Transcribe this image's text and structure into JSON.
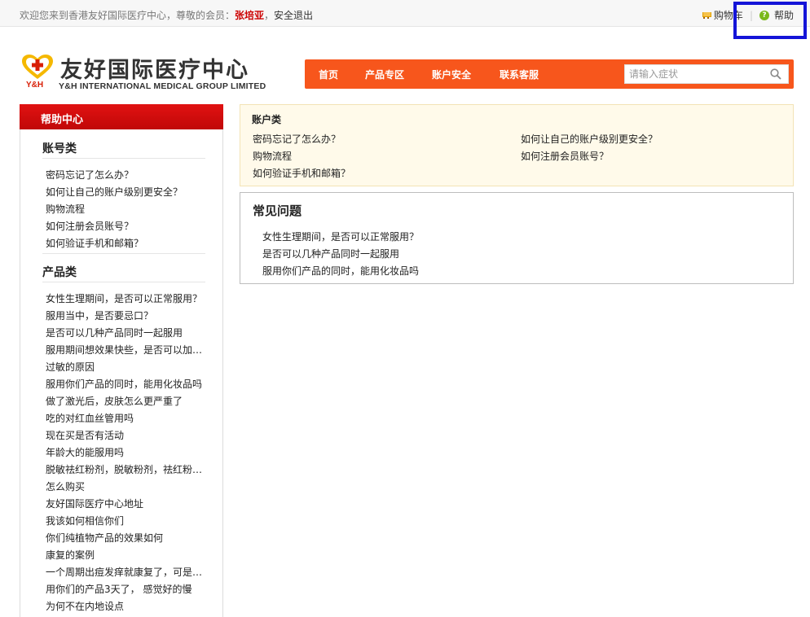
{
  "topbar": {
    "welcome_prefix": "欢迎您来到香港友好国际医疗中心，尊敬的会员：",
    "member_name": "张培亚",
    "logout_sep": "，",
    "logout": "安全退出",
    "cart_label": "购物车",
    "separator": "|",
    "help_label": "帮助"
  },
  "logo": {
    "mark_text": "Y&H",
    "name_cn": "友好国际医疗中心",
    "name_en": "Y&H INTERNATIONAL MEDICAL GROUP LIMITED",
    "brand_red": "#d81e06",
    "brand_yellow": "#f5b800"
  },
  "nav": {
    "items": [
      {
        "label": "首页"
      },
      {
        "label": "产品专区"
      },
      {
        "label": "账户安全"
      },
      {
        "label": "联系客服"
      }
    ],
    "search_placeholder": "请输入症状",
    "color": "#f7561c"
  },
  "sidebar": {
    "header": "帮助中心",
    "header_color": "#cc0b0b",
    "sections": [
      {
        "title": "账号类",
        "items": [
          "密码忘记了怎么办？",
          "如何让自己的账户级别更安全？",
          "购物流程",
          "如何注册会员账号？",
          "如何验证手机和邮箱？"
        ]
      },
      {
        "title": "产品类",
        "items": [
          "女性生理期间，是否可以正常服用？",
          "服用当中，是否要忌口？",
          "是否可以几种产品同时一起服用",
          "服用期间想效果快些，是否可以加…",
          "过敏的原因",
          "服用你们产品的同时，能用化妆品吗",
          "做了激光后，皮肤怎么更严重了",
          "吃的对红血丝管用吗",
          "现在买是否有活动",
          "年龄大的能服用吗",
          "脱敏祛红粉剂，脱敏粉剂，祛红粉…",
          "怎么购买",
          "友好国际医疗中心地址",
          "我该如何相信你们",
          "你们纯植物产品的效果如何",
          "康复的案例",
          "一个周期出痘发痒就康复了，可是…",
          "用你们的产品3天了， 感觉好的慢",
          "为何不在内地设点"
        ]
      }
    ]
  },
  "account_panel": {
    "title": "账户类",
    "links": [
      "密码忘记了怎么办？",
      "如何让自己的账户级别更安全？",
      "购物流程",
      "如何注册会员账号？",
      "如何验证手机和邮箱？"
    ]
  },
  "faq_panel": {
    "title": "常见问题",
    "links": [
      "女性生理期间，是否可以正常服用？",
      "是否可以几种产品同时一起服用",
      "服用你们产品的同时，能用化妆品吗"
    ]
  }
}
